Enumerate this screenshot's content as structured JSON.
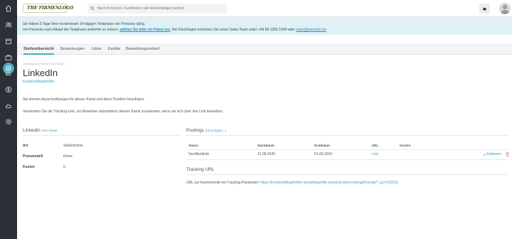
{
  "brand": {
    "logo_text": "THE FIRMENLOGO",
    "accent": "#4aa9c4",
    "sidebar_bg": "#2b2f36"
  },
  "sidebar": {
    "items": [
      {
        "icon": "home-icon"
      },
      {
        "icon": "people-icon"
      },
      {
        "icon": "calendar-icon"
      },
      {
        "icon": "briefcase-icon"
      },
      {
        "icon": "recruiting-icon"
      },
      {
        "icon": "chart-icon"
      },
      {
        "icon": "money-icon"
      },
      {
        "icon": "cloud-icon"
      },
      {
        "icon": "settings-icon"
      }
    ]
  },
  "header": {
    "search_placeholder": "Nach Personen, Funktionen oder Einstellungen suchen"
  },
  "banner": {
    "line1": "Sie haben 9 Tage Ihrer kostenlosen 14-tägigen Testphase von Personio übrig.",
    "line2_prefix": "Um Personio nach Ablauf der Testphase weiterhin zu nutzen,",
    "line2_link": "wählen Sie bitte ein Paket aus",
    "line2_middle": ". Bei Rückfragen erreichen Sie unser Sales Team unter +49 89 1250 1004 oder",
    "line2_email": "sales@personio.de"
  },
  "tabs": [
    {
      "label": "Stellenübersicht",
      "active": true
    },
    {
      "label": "Bewerbungen",
      "active": false
    },
    {
      "label": "Inbox",
      "active": false
    },
    {
      "label": "Kanäle",
      "active": false
    },
    {
      "label": "Bewerbungsverlauf",
      "active": false
    }
  ],
  "page": {
    "meta": "Tracking Link erstellt: 28.10.2020",
    "title": "LinkedIn",
    "subtitle_link": "Krankenpflegehelfer",
    "para1": "Sie können Ausschreibungen für diesen Kanal und diese Position hinzufügen.",
    "para2": "Verwenden Sie die Tracking-Link, um Bewerber automatisch diesem Kanal zuzuweisen, wenn sie sich über den Link bewerben."
  },
  "channel": {
    "title": "LinkedIn",
    "link": "Zum Kanal",
    "rows": [
      {
        "label": "Art",
        "value": "Stellenbörse"
      },
      {
        "label": "Preismodell",
        "value": "Keine"
      },
      {
        "label": "Kosten",
        "value": "0"
      }
    ]
  },
  "postings": {
    "title": "Postings",
    "add_link": "(Hinzufügen...)",
    "columns": [
      "Status",
      "Startdatum",
      "Enddatum",
      "URL",
      "Kosten"
    ],
    "rows": [
      {
        "status": "Veröffentlicht",
        "start": "31.08.2020",
        "end": "01.09.2020",
        "url": "Link",
        "cost": "",
        "edit": "Editieren"
      }
    ]
  },
  "tracking": {
    "title": "Tracking URL",
    "label": "URL zur Karriereseite mit Tracking-Parameter:",
    "url": "https://krankenpflegehelfer-nesspflegehilfe.personio.de/recruiting/formular?_pc=222503"
  }
}
